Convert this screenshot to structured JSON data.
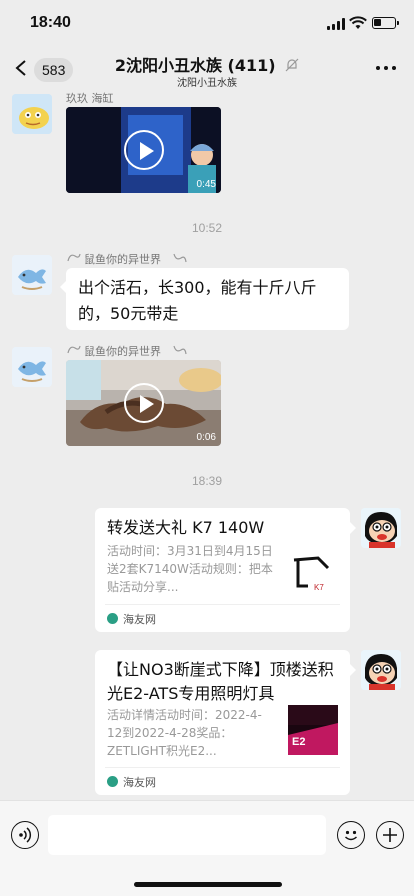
{
  "status_bar": {
    "time": "18:40"
  },
  "nav": {
    "unread_count": "583",
    "title": "2沈阳小丑水族 (411)",
    "subtitle": "沈阳小丑水族"
  },
  "messages": [
    {
      "sender": "玖玖 海缸",
      "type": "video",
      "duration": "0:45"
    },
    {
      "timestamp": "10:52"
    },
    {
      "sender": "鼠鱼你的异世界",
      "type": "text",
      "text": "出个活石，长300，能有十斤八斤的，50元带走"
    },
    {
      "sender": "鼠鱼你的异世界",
      "type": "video",
      "duration": "0:06"
    },
    {
      "timestamp": "18:39"
    },
    {
      "type": "link_card",
      "title": "转发送大礼 K7 140W",
      "description": "活动时间：3月31日到4月15日送2套K7140W活动规则：把本贴活动分享...",
      "source": "海友网",
      "thumb_text": "K7"
    },
    {
      "type": "link_card",
      "title": "【让NO3断崖式下降】顶楼送积光E2-ATS专用照明灯具",
      "description": "活动详情活动时间：2022-4-12到2022-4-28奖品：ZETLIGHT积光E2...",
      "source": "海友网",
      "thumb_text": "E2"
    }
  ],
  "input_bar": {
    "placeholder": ""
  },
  "colors": {
    "background": "#ededed",
    "bubble": "#ffffff",
    "link_source_dot": "#2a9f85"
  }
}
